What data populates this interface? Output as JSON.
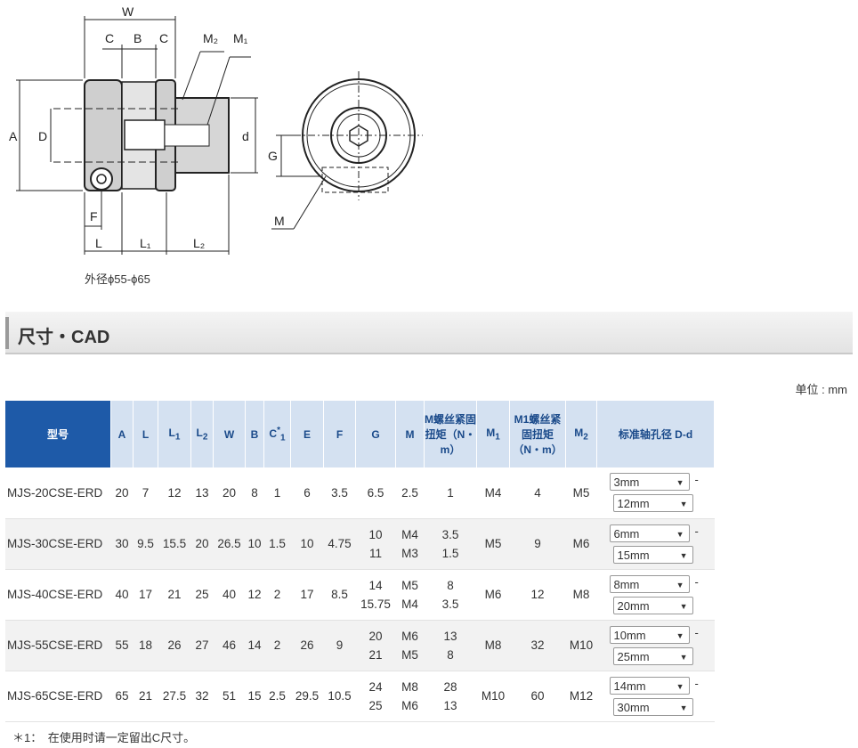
{
  "drawing": {
    "labels": {
      "W": "W",
      "C": "C",
      "B": "B",
      "M2": "M₂",
      "M1": "M₁",
      "A": "A",
      "D": "D",
      "d": "d",
      "G": "G",
      "F": "F",
      "L": "L",
      "L1": "L₁",
      "L2": "L₂",
      "M": "M"
    },
    "caption": "外径ϕ55-ϕ65"
  },
  "section": {
    "title": "尺寸・CAD"
  },
  "unit": "单位 : mm",
  "table": {
    "headers": {
      "model": "型号",
      "A": "A",
      "L": "L",
      "L1": "L",
      "L1_sub": "1",
      "L2": "L",
      "L2_sub": "2",
      "W": "W",
      "B": "B",
      "C1": "C",
      "C1_sub": "1",
      "C1_sup": "*",
      "E": "E",
      "F": "F",
      "G": "G",
      "M": "M",
      "M_torque": "M螺丝紧固扭矩（N・m）",
      "M1": "M",
      "M1_sub": "1",
      "M1_torque": "M1螺丝紧固扭矩（N・m）",
      "M2": "M",
      "M2_sub": "2",
      "bore": "标准轴孔径 D-d"
    },
    "rows": [
      {
        "model": "MJS-20CSE-ERD",
        "A": "20",
        "L": "7",
        "L1": "12",
        "L2": "13",
        "W": "20",
        "B": "8",
        "C1": "1",
        "E": "6",
        "F": "3.5",
        "G": "6.5",
        "M": "2.5",
        "M_torque": "1",
        "M1": "M4",
        "M1_torque": "4",
        "M2": "M5",
        "D": "3mm",
        "d": "12mm",
        "dash": "-"
      },
      {
        "model": "MJS-30CSE-ERD",
        "A": "30",
        "L": "9.5",
        "L1": "15.5",
        "L2": "20",
        "W": "26.5",
        "B": "10",
        "C1": "1.5",
        "E": "10",
        "F": "4.75",
        "G": "10\n11",
        "M": "M4\nM3",
        "M_torque": "3.5\n1.5",
        "M1": "M5",
        "M1_torque": "9",
        "M2": "M6",
        "D": "6mm",
        "d": "15mm",
        "dash": "-"
      },
      {
        "model": "MJS-40CSE-ERD",
        "A": "40",
        "L": "17",
        "L1": "21",
        "L2": "25",
        "W": "40",
        "B": "12",
        "C1": "2",
        "E": "17",
        "F": "8.5",
        "G": "14\n15.75",
        "M": "M5\nM4",
        "M_torque": "8\n3.5",
        "M1": "M6",
        "M1_torque": "12",
        "M2": "M8",
        "D": "8mm",
        "d": "20mm",
        "dash": "-"
      },
      {
        "model": "MJS-55CSE-ERD",
        "A": "55",
        "L": "18",
        "L1": "26",
        "L2": "27",
        "W": "46",
        "B": "14",
        "C1": "2",
        "E": "26",
        "F": "9",
        "G": "20\n21",
        "M": "M6\nM5",
        "M_torque": "13\n8",
        "M1": "M8",
        "M1_torque": "32",
        "M2": "M10",
        "D": "10mm",
        "d": "25mm",
        "dash": "-"
      },
      {
        "model": "MJS-65CSE-ERD",
        "A": "65",
        "L": "21",
        "L1": "27.5",
        "L2": "32",
        "W": "51",
        "B": "15",
        "C1": "2.5",
        "E": "29.5",
        "F": "10.5",
        "G": "24\n25",
        "M": "M8\nM6",
        "M_torque": "28\n13",
        "M1": "M10",
        "M1_torque": "60",
        "M2": "M12",
        "D": "14mm",
        "d": "30mm",
        "dash": "-"
      }
    ]
  },
  "footnote": "＊1：　在使用时请一定留出C尺寸。"
}
